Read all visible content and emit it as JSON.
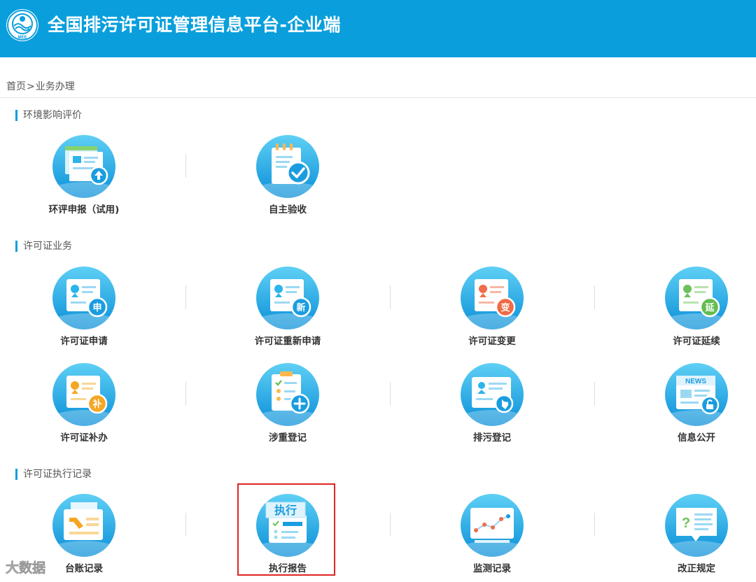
{
  "header": {
    "title": "全国排污许可证管理信息平台-企业端",
    "logo_text": "MEE",
    "brand_color": "#0a9fdc"
  },
  "breadcrumb": {
    "home": "首页",
    "separator": ">",
    "current": "业务办理"
  },
  "sections": [
    {
      "title": "环境影响评价",
      "items": [
        {
          "label": "环评申报（试用)",
          "icon": "eia-report-icon"
        },
        {
          "label": "自主验收",
          "icon": "self-acceptance-icon"
        }
      ]
    },
    {
      "title": "许可证业务",
      "items": [
        {
          "label": "许可证申请",
          "icon": "license-apply-icon",
          "badge": "申"
        },
        {
          "label": "许可证重新申请",
          "icon": "license-reapply-icon",
          "badge": "新"
        },
        {
          "label": "许可证变更",
          "icon": "license-change-icon",
          "badge": "变"
        },
        {
          "label": "许可证延续",
          "icon": "license-extend-icon",
          "badge": "延"
        },
        {
          "label": "许可证补办",
          "icon": "license-reissue-icon",
          "badge": "补"
        },
        {
          "label": "涉重登记",
          "icon": "heavy-metal-register-icon"
        },
        {
          "label": "排污登记",
          "icon": "pollutant-register-icon"
        },
        {
          "label": "信息公开",
          "icon": "info-disclosure-icon",
          "badge": "NEWS"
        }
      ]
    },
    {
      "title": "许可证执行记录",
      "items": [
        {
          "label": "台账记录",
          "icon": "ledger-record-icon"
        },
        {
          "label": "执行报告",
          "icon": "execution-report-icon",
          "badge": "执行"
        },
        {
          "label": "监测记录",
          "icon": "monitoring-record-icon"
        },
        {
          "label": "改正规定",
          "icon": "rectification-icon"
        }
      ]
    }
  ],
  "highlighted_item": "执行报告",
  "watermark": "大数据"
}
